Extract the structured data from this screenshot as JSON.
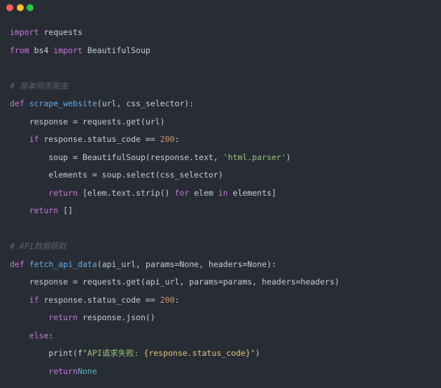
{
  "window": {
    "controls": [
      {
        "name": "close",
        "color": "#ff5f57"
      },
      {
        "name": "minimize",
        "color": "#febc2e"
      },
      {
        "name": "maximize",
        "color": "#28c840"
      }
    ]
  },
  "colors": {
    "background": "#282c34",
    "plain": "#c8ccd4",
    "keyword": "#c678dd",
    "function": "#61afef",
    "number": "#d19a66",
    "string": "#98c379",
    "comment": "#5c6370",
    "interp": "#e5c07b",
    "constant": "#56b6c2"
  },
  "code": {
    "language": "python",
    "lines": [
      [
        {
          "t": "kw",
          "v": "import"
        },
        {
          "t": "plain",
          "v": " requests"
        }
      ],
      [
        {
          "t": "kw",
          "v": "from"
        },
        {
          "t": "plain",
          "v": " bs4 "
        },
        {
          "t": "kw",
          "v": "import"
        },
        {
          "t": "plain",
          "v": " BeautifulSoup"
        }
      ],
      [],
      [
        {
          "t": "comment",
          "v": "# 简单网页爬虫"
        }
      ],
      [
        {
          "t": "kw",
          "v": "def"
        },
        {
          "t": "plain",
          "v": " "
        },
        {
          "t": "fn",
          "v": "scrape_website"
        },
        {
          "t": "plain",
          "v": "(url, css_selector):"
        }
      ],
      [
        {
          "t": "plain",
          "v": "    response = requests.get(url)"
        }
      ],
      [
        {
          "t": "plain",
          "v": "    "
        },
        {
          "t": "kw",
          "v": "if"
        },
        {
          "t": "plain",
          "v": " response.status_code == "
        },
        {
          "t": "num",
          "v": "200"
        },
        {
          "t": "plain",
          "v": ":"
        }
      ],
      [
        {
          "t": "plain",
          "v": "        soup = BeautifulSoup(response.text, "
        },
        {
          "t": "str",
          "v": "'html.parser'"
        },
        {
          "t": "plain",
          "v": ")"
        }
      ],
      [
        {
          "t": "plain",
          "v": "        elements = soup.select(css_selector)"
        }
      ],
      [
        {
          "t": "plain",
          "v": "        "
        },
        {
          "t": "kw",
          "v": "return"
        },
        {
          "t": "plain",
          "v": " [elem.text.strip() "
        },
        {
          "t": "kw",
          "v": "for"
        },
        {
          "t": "plain",
          "v": " elem "
        },
        {
          "t": "kw",
          "v": "in"
        },
        {
          "t": "plain",
          "v": " elements]"
        }
      ],
      [
        {
          "t": "plain",
          "v": "    "
        },
        {
          "t": "kw",
          "v": "return"
        },
        {
          "t": "plain",
          "v": " []"
        }
      ],
      [],
      [
        {
          "t": "comment",
          "v": "# API数据获取"
        }
      ],
      [
        {
          "t": "kw",
          "v": "def"
        },
        {
          "t": "plain",
          "v": " "
        },
        {
          "t": "fn",
          "v": "fetch_api_data"
        },
        {
          "t": "plain",
          "v": "(api_url, params=None, headers=None):"
        }
      ],
      [
        {
          "t": "plain",
          "v": "    response = requests.get(api_url, params=params, headers=headers)"
        }
      ],
      [
        {
          "t": "plain",
          "v": "    "
        },
        {
          "t": "kw",
          "v": "if"
        },
        {
          "t": "plain",
          "v": " response.status_code == "
        },
        {
          "t": "num",
          "v": "200"
        },
        {
          "t": "plain",
          "v": ":"
        }
      ],
      [
        {
          "t": "plain",
          "v": "        "
        },
        {
          "t": "kw",
          "v": "return"
        },
        {
          "t": "plain",
          "v": " response.json()"
        }
      ],
      [
        {
          "t": "plain",
          "v": "    "
        },
        {
          "t": "kw",
          "v": "else"
        },
        {
          "t": "plain",
          "v": ":"
        }
      ],
      [
        {
          "t": "plain",
          "v": "        print(f"
        },
        {
          "t": "str",
          "v": "\"API请求失败: "
        },
        {
          "t": "interp",
          "v": "{response.status_code}"
        },
        {
          "t": "str",
          "v": "\""
        },
        {
          "t": "plain",
          "v": ")"
        }
      ],
      [
        {
          "t": "plain",
          "v": "        "
        },
        {
          "t": "kw",
          "v": "return"
        },
        {
          "t": "const",
          "v": "None"
        }
      ]
    ]
  }
}
